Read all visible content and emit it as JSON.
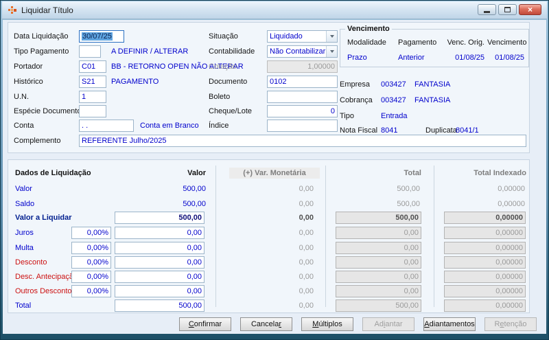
{
  "colors": {
    "accent_blue": "#0000cc",
    "alert_red": "#cc1111",
    "navy_bold": "#001f8f",
    "disabled_text": "#9a9a9a",
    "close_button": "#c14a3b",
    "panel_bg": "#f1f6fb"
  },
  "window": {
    "title": "Liquidar Título"
  },
  "form": {
    "data_liquidacao": {
      "label": "Data Liquidação",
      "value": "30/07/25"
    },
    "tipo_pagamento": {
      "label": "Tipo Pagamento",
      "value": "",
      "desc": "A DEFINIR / ALTERAR"
    },
    "portador": {
      "label": "Portador",
      "value": "C01",
      "desc": "BB - RETORNO OPEN NÃO ALTERAR"
    },
    "historico": {
      "label": "Histórico",
      "value": "S21",
      "desc": "PAGAMENTO"
    },
    "un": {
      "label": "U.N.",
      "value": "1"
    },
    "especie": {
      "label": "Espécie Documento",
      "value": ""
    },
    "conta": {
      "label": "Conta",
      "value": ". .",
      "desc": "Conta em Branco"
    },
    "complemento": {
      "label": "Complemento",
      "value": "REFERENTE Julho/2025"
    },
    "situacao": {
      "label": "Situação",
      "value": "Liquidado"
    },
    "contabilidade": {
      "label": "Contabilidade",
      "value": "Não Contabilizar"
    },
    "cotacao": {
      "label": "Cotação",
      "value": "1,00000"
    },
    "documento": {
      "label": "Documento",
      "value": "0102"
    },
    "boleto": {
      "label": "Boleto",
      "value": ""
    },
    "cheque_lote": {
      "label": "Cheque/Lote",
      "value": "0"
    },
    "indice": {
      "label": "Índice",
      "value": ""
    }
  },
  "vencimento": {
    "title": "Vencimento",
    "cols": [
      {
        "h": "Modalidade",
        "v": "Prazo"
      },
      {
        "h": "Pagamento",
        "v": "Anterior"
      },
      {
        "h": "Venc. Orig.",
        "v": "01/08/25"
      },
      {
        "h": "Vencimento",
        "v": "01/08/25"
      }
    ]
  },
  "info": {
    "empresa": {
      "label": "Empresa",
      "code": "003427",
      "name": "FANTASIA"
    },
    "cobranca": {
      "label": "Cobrança",
      "code": "003427",
      "name": "FANTASIA"
    },
    "tipo": {
      "label": "Tipo",
      "value": "Entrada"
    },
    "nota": {
      "label": "Nota Fiscal",
      "value": "8041",
      "dup_label": "Duplicata",
      "dup_value": "8041/1"
    }
  },
  "grid": {
    "headers": {
      "dados": "Dados de Liquidação",
      "valor": "Valor",
      "var_monetaria": "(+) Var. Monetária",
      "total": "Total",
      "total_indexado": "Total Indexado"
    },
    "rows": [
      {
        "label": "Valor",
        "valor": "500,00",
        "var": "0,00",
        "total": "500,00",
        "tidx": "0,00000"
      },
      {
        "label": "Saldo",
        "valor": "500,00",
        "var": "0,00",
        "total": "500,00",
        "tidx": "0,00000"
      },
      {
        "label": "Valor a Liquidar",
        "valor": "500,00",
        "var": "0,00",
        "total": "500,00",
        "tidx": "0,00000"
      },
      {
        "label": "Juros",
        "pct": "0,00%",
        "valor": "0,00",
        "var": "0,00",
        "total": "0,00",
        "tidx": "0,00000"
      },
      {
        "label": "Multa",
        "pct": "0,00%",
        "valor": "0,00",
        "var": "0,00",
        "total": "0,00",
        "tidx": "0,00000"
      },
      {
        "label": "Desconto",
        "pct": "0,00%",
        "valor": "0,00",
        "var": "0,00",
        "total": "0,00",
        "tidx": "0,00000"
      },
      {
        "label": "Desc. Antecipação",
        "pct": "0,00%",
        "valor": "0,00",
        "var": "0,00",
        "total": "0,00",
        "tidx": "0,00000"
      },
      {
        "label": "Outros Descontos",
        "pct": "0,00%",
        "valor": "0,00",
        "var": "0,00",
        "total": "0,00",
        "tidx": "0,00000"
      },
      {
        "label": "Total",
        "valor": "500,00",
        "var": "0,00",
        "total": "500,00",
        "tidx": "0,00000"
      }
    ]
  },
  "buttons": [
    {
      "pre": "",
      "key": "C",
      "post": "onfirmar"
    },
    {
      "pre": "Cancela",
      "key": "r",
      "post": ""
    },
    {
      "pre": "",
      "key": "M",
      "post": "últiplos"
    },
    {
      "pre": "Ad",
      "key": "i",
      "post": "antar"
    },
    {
      "pre": "",
      "key": "A",
      "post": "diantamentos"
    },
    {
      "pre": "R",
      "key": "e",
      "post": "tenção"
    }
  ]
}
